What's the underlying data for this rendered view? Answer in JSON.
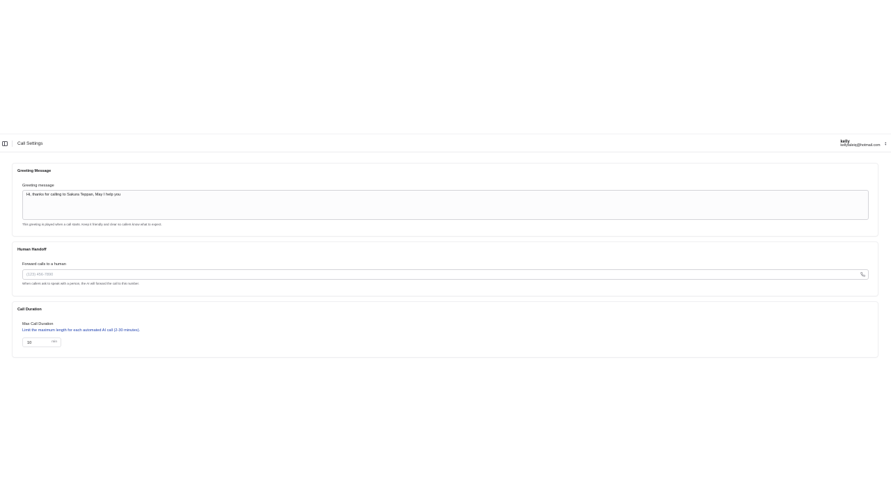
{
  "header": {
    "title": "Call Settings",
    "user": {
      "name": "kelly",
      "email": "kellytaleiq@hotmail.com"
    }
  },
  "greeting": {
    "section_title": "Greeting Message",
    "label": "Greeting message",
    "value": "Hi, thanks for calling to Sakura Teppan, May I help you",
    "hint": "This greeting is played when a call starts. Keep it friendly and clear so callers know what to expect."
  },
  "handoff": {
    "section_title": "Human Handoff",
    "label": "Forward calls to a human",
    "placeholder": "(123) 456-7890",
    "hint": "When callers ask to speak with a person, the AI will forward the call to this number."
  },
  "duration": {
    "section_title": "Call Duration",
    "label": "Max Call Duration",
    "hint": "Limit the maximum length for each automated AI call (2-30 minutes).",
    "value": "10",
    "unit": "min"
  },
  "colors": {
    "accent_blue": "#1e40af"
  },
  "icons": {
    "sidebar": "sidebar-toggle-icon",
    "user_menu": "chevrons-up-down-icon",
    "phone": "phone-icon"
  }
}
